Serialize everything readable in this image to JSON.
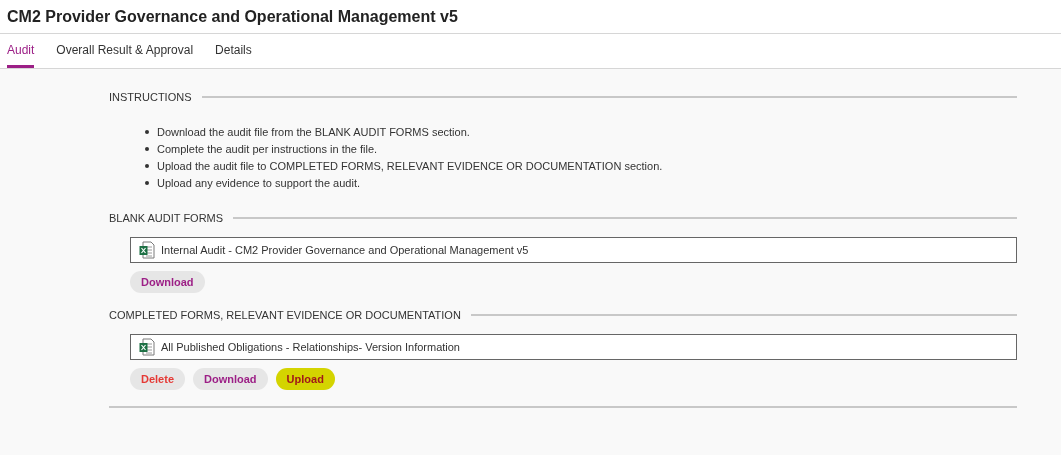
{
  "title": "CM2 Provider Governance and Operational Management v5",
  "tabs": [
    {
      "label": "Audit",
      "selected": true
    },
    {
      "label": "Overall Result & Approval",
      "selected": false
    },
    {
      "label": "Details",
      "selected": false
    }
  ],
  "instructions": {
    "heading": "INSTRUCTIONS",
    "items": [
      "Download the audit file from the BLANK AUDIT FORMS section.",
      "Complete the audit per instructions in the file.",
      "Upload the audit file to COMPLETED FORMS, RELEVANT EVIDENCE OR DOCUMENTATION section.",
      "Upload any evidence to support the audit."
    ]
  },
  "sections": [
    {
      "heading": "BLANK AUDIT FORMS",
      "file": "Internal Audit - CM2 Provider Governance and Operational Management v5",
      "buttons": [
        {
          "label": "Download",
          "kind": "download",
          "highlighted": false
        }
      ]
    },
    {
      "heading": "COMPLETED FORMS, RELEVANT EVIDENCE OR DOCUMENTATION",
      "file": "All Published Obligations - Relationships- Version Information",
      "buttons": [
        {
          "label": "Delete",
          "kind": "delete",
          "highlighted": false
        },
        {
          "label": "Download",
          "kind": "download",
          "highlighted": false
        },
        {
          "label": "Upload",
          "kind": "upload",
          "highlighted": true
        }
      ]
    }
  ]
}
